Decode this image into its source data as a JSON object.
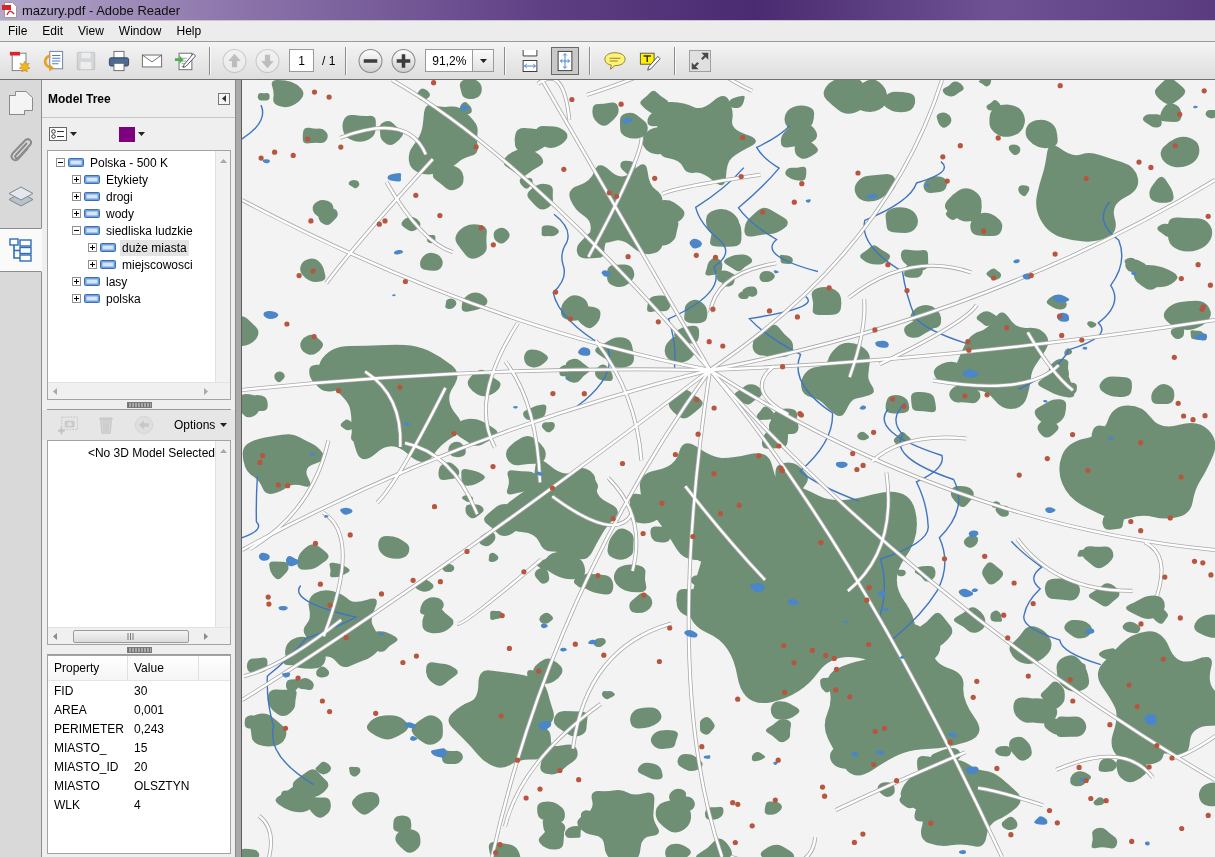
{
  "window": {
    "title": "mazury.pdf - Adobe Reader"
  },
  "menu_bar": [
    "File",
    "Edit",
    "View",
    "Window",
    "Help"
  ],
  "toolbar": {
    "file_tools": [
      {
        "kind": "create",
        "disabled": false
      },
      {
        "kind": "share",
        "disabled": false
      },
      {
        "kind": "save",
        "disabled": true
      },
      {
        "kind": "print",
        "disabled": false
      },
      {
        "kind": "email",
        "disabled": false
      },
      {
        "kind": "sign",
        "disabled": false
      }
    ],
    "page_navigation": [
      {
        "kind": "previous",
        "disabled": true
      },
      {
        "kind": "next",
        "disabled": true
      }
    ],
    "page_field": {
      "value": "1"
    },
    "page_total": "/ 1",
    "zoom_buttons": [
      {
        "kind": "zoom-out"
      },
      {
        "kind": "zoom-in"
      }
    ],
    "zoom_field": {
      "value": "91,2%"
    },
    "view_modes": [
      {
        "kind": "fit-width",
        "selected": false
      },
      {
        "kind": "fit-page",
        "selected": true
      }
    ],
    "comment_tools": [
      {
        "kind": "comment"
      },
      {
        "kind": "highlight"
      }
    ],
    "display_tools": [
      {
        "kind": "full-screen"
      }
    ]
  },
  "navigation_panel": [
    {
      "kind": "pages",
      "selected": false
    },
    {
      "kind": "attachments",
      "selected": false
    },
    {
      "kind": "layers",
      "selected": false
    },
    {
      "kind": "model-tree",
      "selected": true
    }
  ],
  "model_tree": {
    "title": "Model Tree",
    "color_swatch": {
      "color": "#7f007f"
    },
    "tree": [
      {
        "label": "Polska - 500 K",
        "expanded": true,
        "selected": false,
        "children": [
          {
            "label": "Etykiety",
            "expanded": false,
            "selected": false
          },
          {
            "label": "drogi",
            "expanded": false,
            "selected": false
          },
          {
            "label": "wody",
            "expanded": false,
            "selected": false
          },
          {
            "label": "siedliska ludzkie",
            "expanded": true,
            "selected": false,
            "children": [
              {
                "label": "duże miasta",
                "expanded": false,
                "selected": true
              },
              {
                "label": "miejscowosci",
                "expanded": false,
                "selected": false
              }
            ]
          },
          {
            "label": "lasy",
            "expanded": false,
            "selected": false
          },
          {
            "label": "polska",
            "expanded": false,
            "selected": false
          }
        ]
      }
    ],
    "view_tools": [
      {
        "kind": "camera",
        "disabled": true
      },
      {
        "kind": "delete",
        "disabled": true
      },
      {
        "kind": "back",
        "disabled": true
      }
    ],
    "options_menu": {
      "label": "Options"
    },
    "views_message": "<No 3D Model Selected",
    "properties": {
      "columns": [
        "Property",
        "Value"
      ],
      "rows": [
        {
          "property": "FID",
          "value": "30"
        },
        {
          "property": "AREA",
          "value": "0,001"
        },
        {
          "property": "PERIMETER",
          "value": "0,243"
        },
        {
          "property": "MIASTO_",
          "value": "15"
        },
        {
          "property": "MIASTO_ID",
          "value": "20"
        },
        {
          "property": "MIASTO",
          "value": "OLSZTYN"
        },
        {
          "property": "WLK",
          "value": "4"
        }
      ]
    }
  }
}
